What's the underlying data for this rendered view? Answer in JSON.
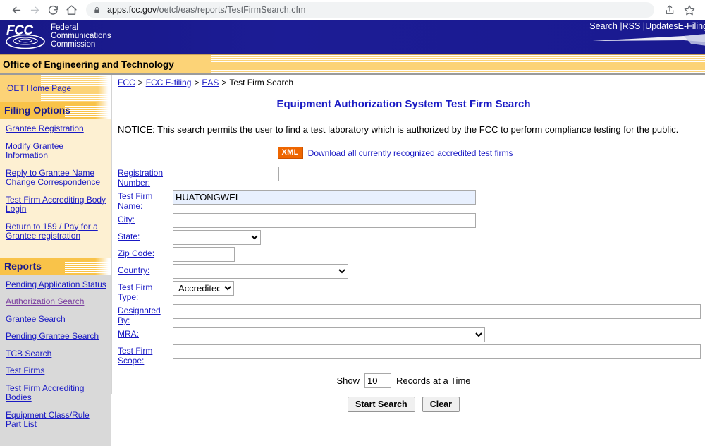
{
  "browser": {
    "url_domain": "apps.fcc.gov",
    "url_path": "/oetcf/eas/reports/TestFirmSearch.cfm",
    "back_icon": "back-arrow-icon",
    "forward_icon": "forward-arrow-icon",
    "reload_icon": "reload-icon",
    "home_icon": "home-icon",
    "lock_icon": "lock-icon",
    "share_icon": "share-icon",
    "bookmark_icon": "star-icon"
  },
  "banner": {
    "logo_letters": "FCC",
    "agency_line1": "Federal",
    "agency_line2": "Communications",
    "agency_line3": "Commission",
    "links": [
      {
        "label": "Search",
        "sep": "|"
      },
      {
        "label": "RSS",
        "sep": " |"
      },
      {
        "label": "Updates",
        "sep": " |"
      },
      {
        "label": "E-Filing",
        "sep": ""
      }
    ],
    "office_bar": "Office of Engineering and Technology"
  },
  "sidebar": {
    "oet_home": "OET Home Page",
    "filing": {
      "header": "Filing Options",
      "items": [
        {
          "label": "Grantee Registration",
          "visited": false
        },
        {
          "label": "Modify Grantee Information",
          "visited": false
        },
        {
          "label": "Reply to Grantee Name Change Correspondence",
          "visited": false
        },
        {
          "label": "Test Firm Accrediting Body Login",
          "visited": false
        },
        {
          "label": "Return to 159 / Pay for a Grantee registration",
          "visited": false
        }
      ]
    },
    "reports": {
      "header": "Reports",
      "items": [
        {
          "label": "Pending Application Status",
          "visited": false
        },
        {
          "label": "Authorization Search",
          "visited": true
        },
        {
          "label": "Grantee Search",
          "visited": false
        },
        {
          "label": "Pending Grantee Search",
          "visited": false
        },
        {
          "label": "TCB Search",
          "visited": false
        },
        {
          "label": "Test Firms",
          "visited": false
        },
        {
          "label": "Test Firm Accrediting Bodies",
          "visited": false
        },
        {
          "label": "Equipment Class/Rule Part List",
          "visited": false
        }
      ]
    }
  },
  "breadcrumb": {
    "items": [
      "FCC",
      "FCC E-filing",
      "EAS"
    ],
    "current": "Test Firm Search",
    "separator": ">"
  },
  "main": {
    "title": "Equipment Authorization System Test Firm Search",
    "notice": "NOTICE: This search permits the user to find a test laboratory which is authorized by the FCC to perform compliance testing for the public.",
    "xml_badge": "XML",
    "xml_link": "Download all currently recognized accredited test firms",
    "fields": {
      "registration_number": {
        "label": "Registration Number:",
        "value": ""
      },
      "test_firm_name": {
        "label": "Test Firm Name:",
        "value": "HUATONGWEI"
      },
      "city": {
        "label": "City:",
        "value": ""
      },
      "state": {
        "label": "State:",
        "value": ""
      },
      "zip_code": {
        "label": "Zip Code:",
        "value": ""
      },
      "country": {
        "label": "Country:",
        "value": ""
      },
      "test_firm_type": {
        "label": "Test Firm Type:",
        "value": "Accredited"
      },
      "designated_by": {
        "label": "Designated By:",
        "value": ""
      },
      "mra": {
        "label": "MRA:",
        "value": ""
      },
      "test_firm_scope": {
        "label": "Test Firm Scope:",
        "value": ""
      }
    },
    "show_prefix": "Show",
    "show_count": "10",
    "show_suffix": "Records at a Time",
    "start_search_label": "Start Search",
    "clear_label": "Clear"
  },
  "colors": {
    "banner_blue": "#1b1b8f",
    "gold": "#fcd377",
    "link_blue": "#1919c4",
    "visited_purple": "#7b3fa0",
    "xml_orange": "#ee6600",
    "focus_field_blue": "#e8f0fe"
  }
}
